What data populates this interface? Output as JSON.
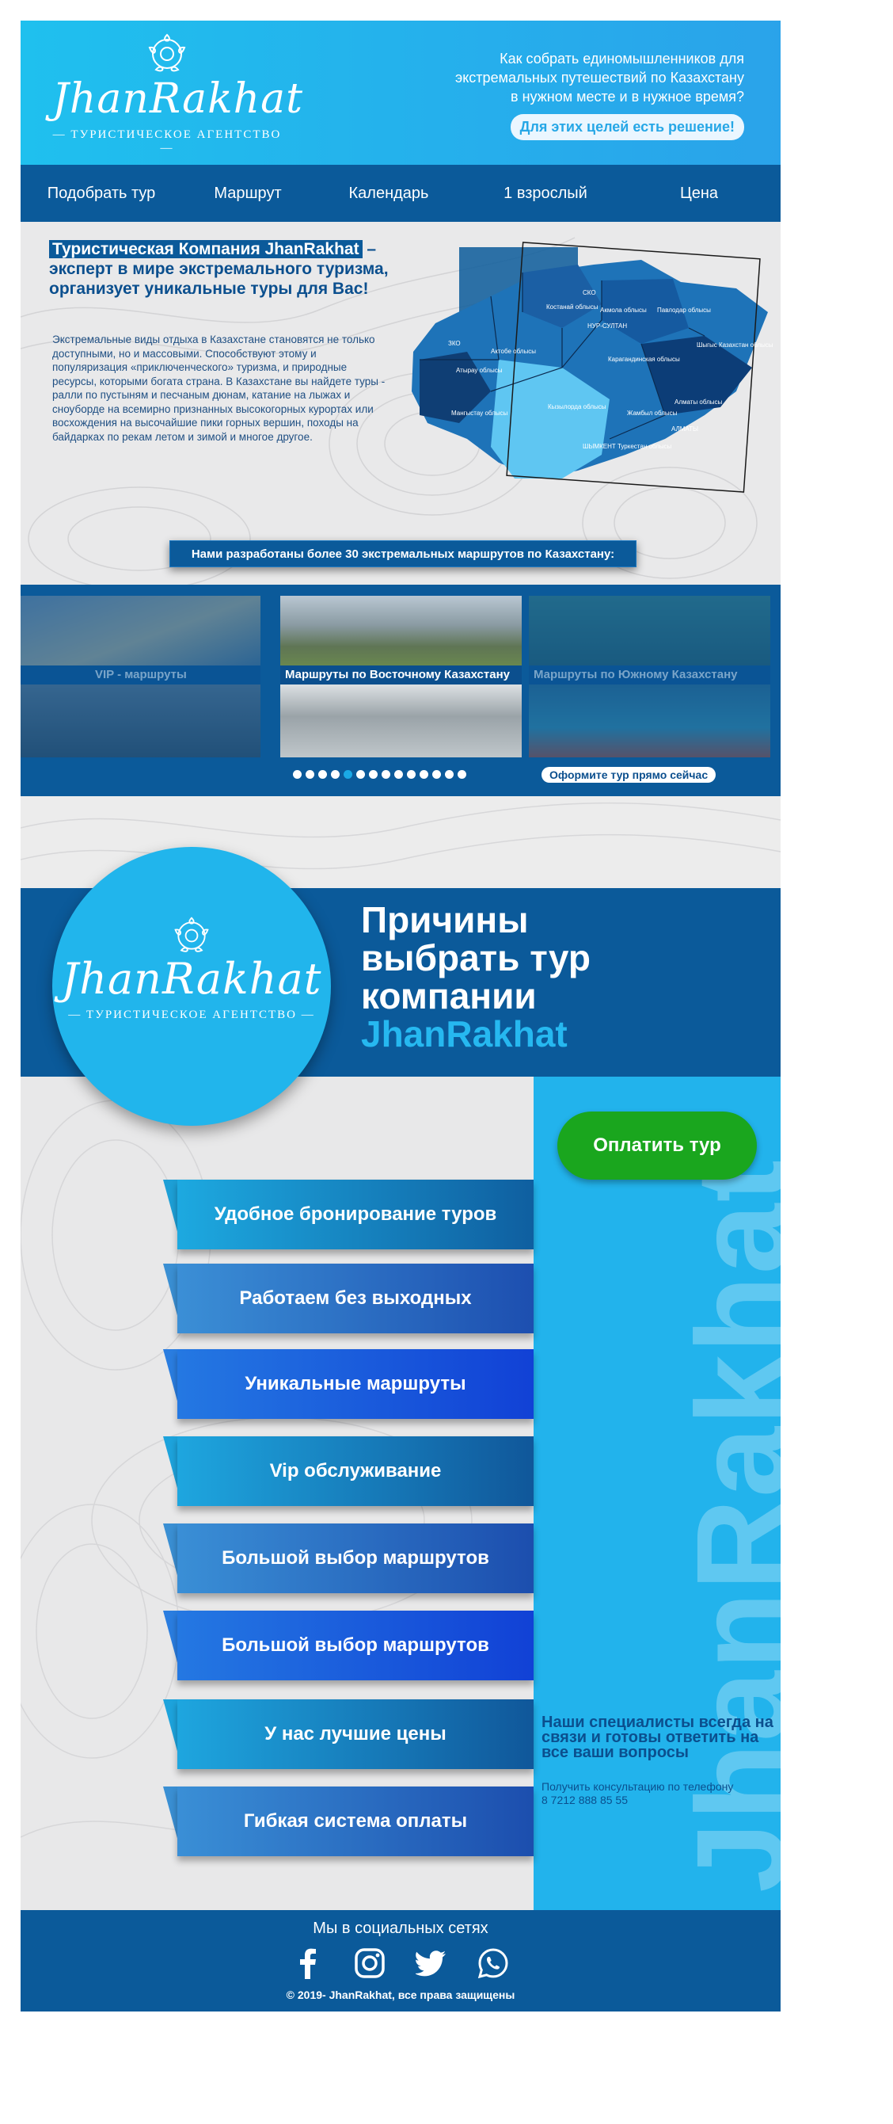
{
  "header": {
    "logo_text": "JhanRakhat",
    "logo_sub": "— ТУРИСТИЧЕСКОЕ   АГЕНТСТВО —",
    "question_lines": [
      "Как собрать единомышленников для",
      "экстремальных путешествий по Казахстану",
      "в нужном месте и в нужное время?"
    ],
    "solution": "Для этих целей есть решение!"
  },
  "nav": {
    "items": [
      "Подобрать тур",
      "Маршрут",
      "Календарь",
      "1 взрослый",
      "Цена"
    ]
  },
  "intro": {
    "title_highlight": "Туристическая Компания JhanRakhat",
    "title_rest": "– эксперт в мире экстремального туризма, организует уникальные туры для Вас!",
    "text": "Экстремальные виды отдыха в Казахстане становятся не только доступными, но и массовыми. Способствуют этому и популяризация «приключенческого» туризма, и природные ресурсы, которыми богата страна. В Казахстане вы найдете туры - ралли по пустыням и песчаным дюнам, катание на лыжах и сноуборде на всемирно признанных высокогорных курортах или восхождения  на высочайшие пики горных вершин, походы на байдарках по рекам летом и зимой и многое другое.",
    "map_labels": [
      "СКО",
      "Костанай облысы",
      "Акмола облысы",
      "Павлодар облысы",
      "НУР-СУЛТАН",
      "ЗКО",
      "Актобе облысы",
      "Атырау облысы",
      "Карагандинская облысы",
      "Шыгыс Казахстан облысы",
      "Мангыстау облысы",
      "Кызылорда облысы",
      "Жамбыл облысы",
      "Алматы облысы",
      "ШЫМКЕНТ Туркестан облысы",
      "АЛМАТЫ"
    ],
    "routes_banner": "Нами разработаны более 30 экстремальных маршрутов по Казахстану:"
  },
  "carousel": {
    "slides": [
      "VIP - маршруты",
      "Маршруты по Восточному Казахстану",
      "Маршруты по Южному Казахстану"
    ],
    "dot_count": 14,
    "active_dot": 5,
    "order_button": "Оформите тур прямо сейчас"
  },
  "reasons": {
    "logo_text": "JhanRakhat",
    "logo_sub": "— ТУРИСТИЧЕСКОЕ   АГЕНТСТВО —",
    "title_lines": [
      "Причины",
      "выбрать тур",
      "компании"
    ],
    "title_brand": "JhanRakhat",
    "pay_button": "Оплатить тур",
    "vertical_brand": "JhanRakhat",
    "items": [
      "Удобное бронирование туров",
      "Работаем без выходных",
      "Уникальные маршруты",
      "Vip обслуживание",
      "Большой выбор маршрутов",
      "Большой выбор маршрутов",
      "У нас лучшие цены",
      "Гибкая система оплаты"
    ],
    "contact_title": "Наши специалисты всегда на связи и готовы ответить на все ваши вопросы",
    "contact_sub": "Получить консультацию по телефону",
    "phone": "8 7212 888 85 55"
  },
  "footer": {
    "title": "Мы в социальных сетях",
    "socials": [
      "facebook-icon",
      "instagram-icon",
      "twitter-icon",
      "whatsapp-icon"
    ],
    "copyright": "© 2019- JhanRakhat, все права защищены"
  },
  "colors": {
    "brand_dark": "#0b5a9a",
    "brand_light": "#22b3ec",
    "pay_green": "#1aa61e",
    "background_grey": "#e8e8e9"
  }
}
